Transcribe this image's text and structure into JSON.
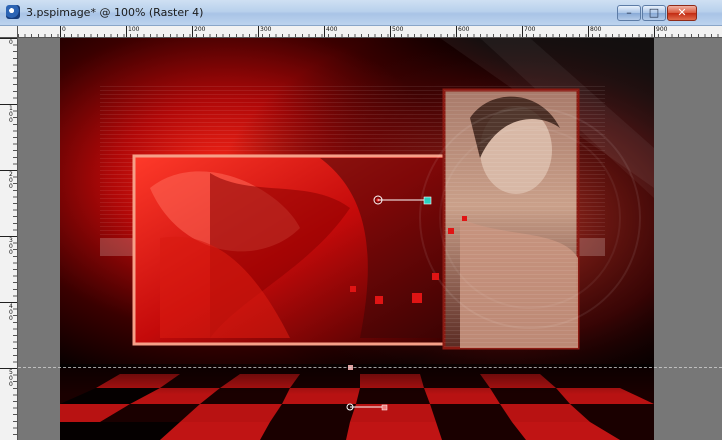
{
  "window": {
    "title": "3.pspimage* @ 100% (Raster 4)",
    "min_glyph": "–",
    "max_glyph": "□",
    "close_glyph": "✕"
  },
  "ruler_top": {
    "labels": [
      "0",
      "100",
      "200",
      "300",
      "400",
      "500",
      "600",
      "700",
      "800",
      "900"
    ]
  },
  "ruler_left": {
    "labels": [
      "0",
      "100",
      "200",
      "300",
      "400",
      "500"
    ]
  },
  "icons": {
    "app": "pspimage-document-icon",
    "minimize": "minimize-icon",
    "maximize": "maximize-icon",
    "close": "close-icon"
  },
  "colors": {
    "accent": "#c41010",
    "canvas_black": "#050000",
    "workspace": "#777777",
    "guide": "#d8d8d8"
  }
}
